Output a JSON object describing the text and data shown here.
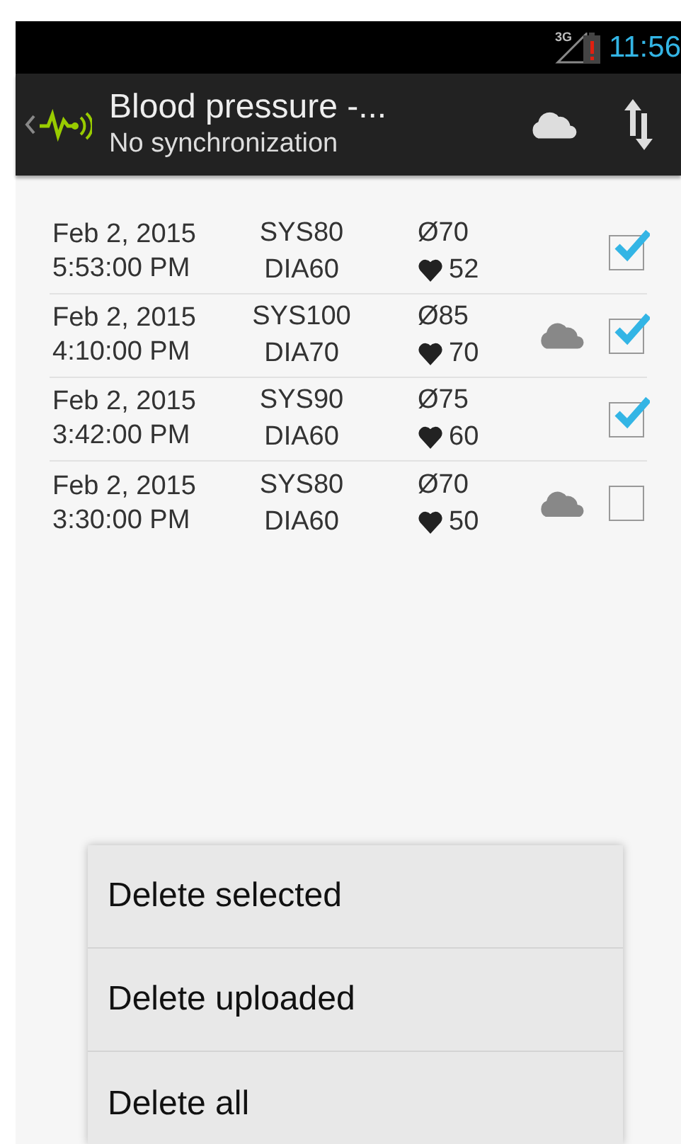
{
  "status_bar": {
    "network": "3G",
    "time": "11:56"
  },
  "action_bar": {
    "title": "Blood pressure -...",
    "subtitle": "No synchronization"
  },
  "rows": [
    {
      "date": "Feb 2, 2015",
      "time": "5:53:00 PM",
      "sys": "SYS80",
      "dia": "DIA60",
      "mean": "Ø70",
      "pulse": "52",
      "uploaded": false,
      "checked": true
    },
    {
      "date": "Feb 2, 2015",
      "time": "4:10:00 PM",
      "sys": "SYS100",
      "dia": "DIA70",
      "mean": "Ø85",
      "pulse": "70",
      "uploaded": true,
      "checked": true
    },
    {
      "date": "Feb 2, 2015",
      "time": "3:42:00 PM",
      "sys": "SYS90",
      "dia": "DIA60",
      "mean": "Ø75",
      "pulse": "60",
      "uploaded": false,
      "checked": true
    },
    {
      "date": "Feb 2, 2015",
      "time": "3:30:00 PM",
      "sys": "SYS80",
      "dia": "DIA60",
      "mean": "Ø70",
      "pulse": "50",
      "uploaded": true,
      "checked": false
    }
  ],
  "menu": {
    "items": [
      {
        "label": "Delete selected"
      },
      {
        "label": "Delete uploaded"
      },
      {
        "label": "Delete all"
      }
    ]
  }
}
